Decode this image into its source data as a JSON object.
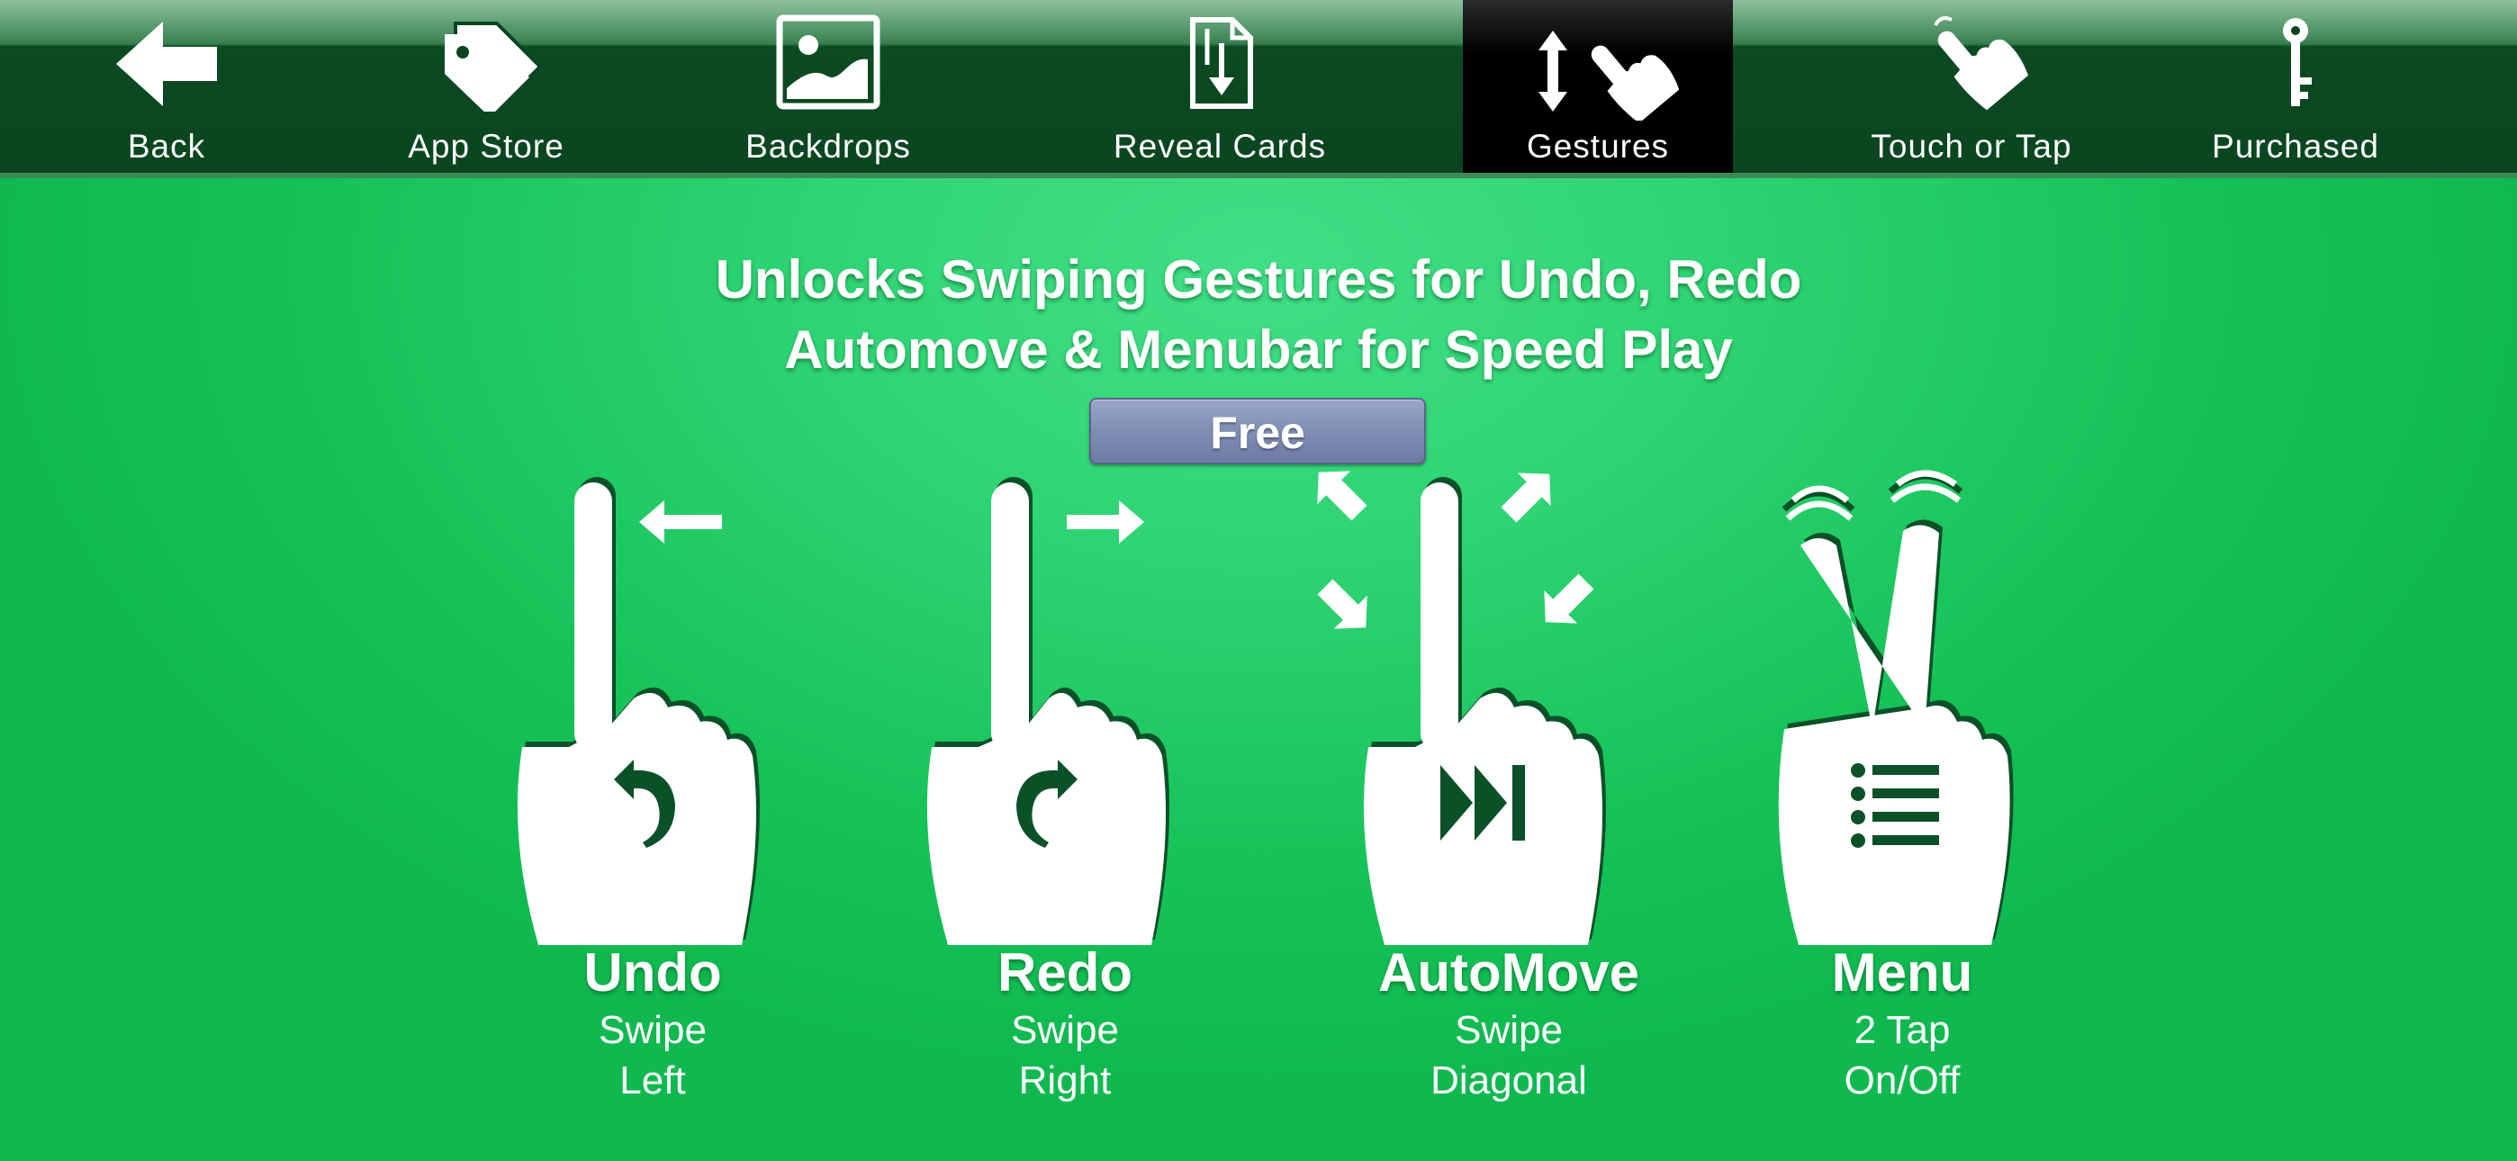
{
  "toolbar": {
    "items": [
      {
        "label": "Back",
        "icon": "back-arrow-icon"
      },
      {
        "label": "App Store",
        "icon": "price-tag-icon"
      },
      {
        "label": "Backdrops",
        "icon": "picture-icon"
      },
      {
        "label": "Reveal Cards",
        "icon": "card-reveal-icon"
      },
      {
        "label": "Gestures",
        "icon": "gestures-icon",
        "active": true
      },
      {
        "label": "Touch or Tap",
        "icon": "tap-hand-icon"
      },
      {
        "label": "Purchased",
        "icon": "key-icon"
      }
    ]
  },
  "main": {
    "heading_line1": "Unlocks Swiping Gestures for Undo, Redo",
    "heading_line2": "Automove & Menubar for Speed Play",
    "price_label": "Free"
  },
  "gestures": [
    {
      "title": "Undo",
      "line1": "Swipe",
      "line2": "Left",
      "icon": "swipe-left-hand-icon"
    },
    {
      "title": "Redo",
      "line1": "Swipe",
      "line2": "Right",
      "icon": "swipe-right-hand-icon"
    },
    {
      "title": "AutoMove",
      "line1": "Swipe",
      "line2": "Diagonal",
      "icon": "swipe-diagonal-hand-icon"
    },
    {
      "title": "Menu",
      "line1": "2 Tap",
      "line2": "On/Off",
      "icon": "two-finger-tap-hand-icon"
    }
  ],
  "colors": {
    "background": "#2fd474",
    "toolbar": "#0a4520",
    "active_tab": "#000000",
    "icon_dark": "#0b5128",
    "price_button": "#8390b6"
  }
}
